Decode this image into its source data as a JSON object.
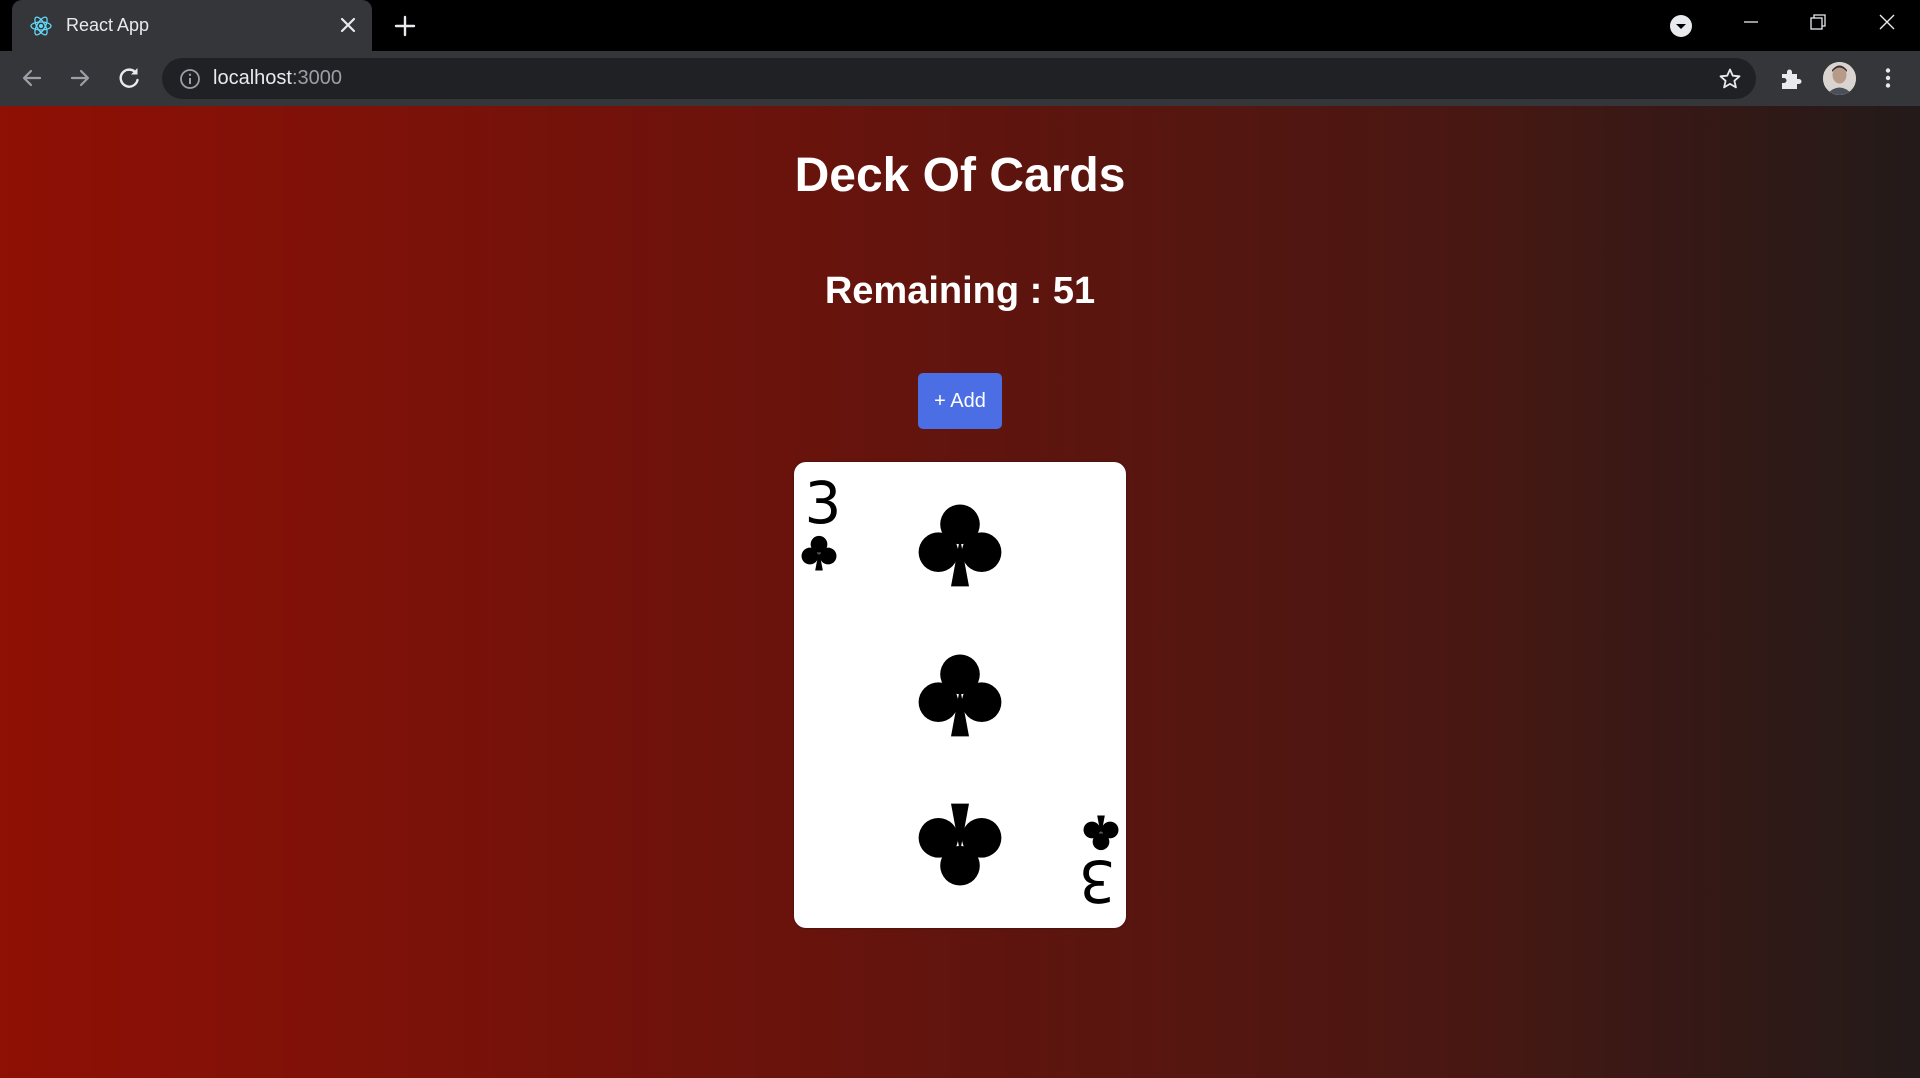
{
  "browser": {
    "tab_title": "React App",
    "url_host": "localhost",
    "url_port": ":3000",
    "icons": {
      "favicon": "react-logo-icon",
      "tab_close": "close-icon",
      "new_tab": "plus-icon",
      "tab_search": "chevron-down-icon",
      "back": "arrow-left-icon",
      "forward": "arrow-right-icon",
      "reload": "reload-icon",
      "site_info": "info-icon",
      "bookmark": "star-icon",
      "extensions": "puzzle-icon",
      "profile": "avatar",
      "menu": "more-vert-icon"
    }
  },
  "page": {
    "title": "Deck Of Cards",
    "remaining_text": "Remaining : 51",
    "add_button_label": "+ Add",
    "card": {
      "rank": "3",
      "suit": "clubs",
      "suit_icon": "club-icon"
    },
    "colors": {
      "background_start": "#8f1005",
      "background_end": "#231a19",
      "button": "#4b6ee4",
      "text": "#ffffff"
    }
  }
}
